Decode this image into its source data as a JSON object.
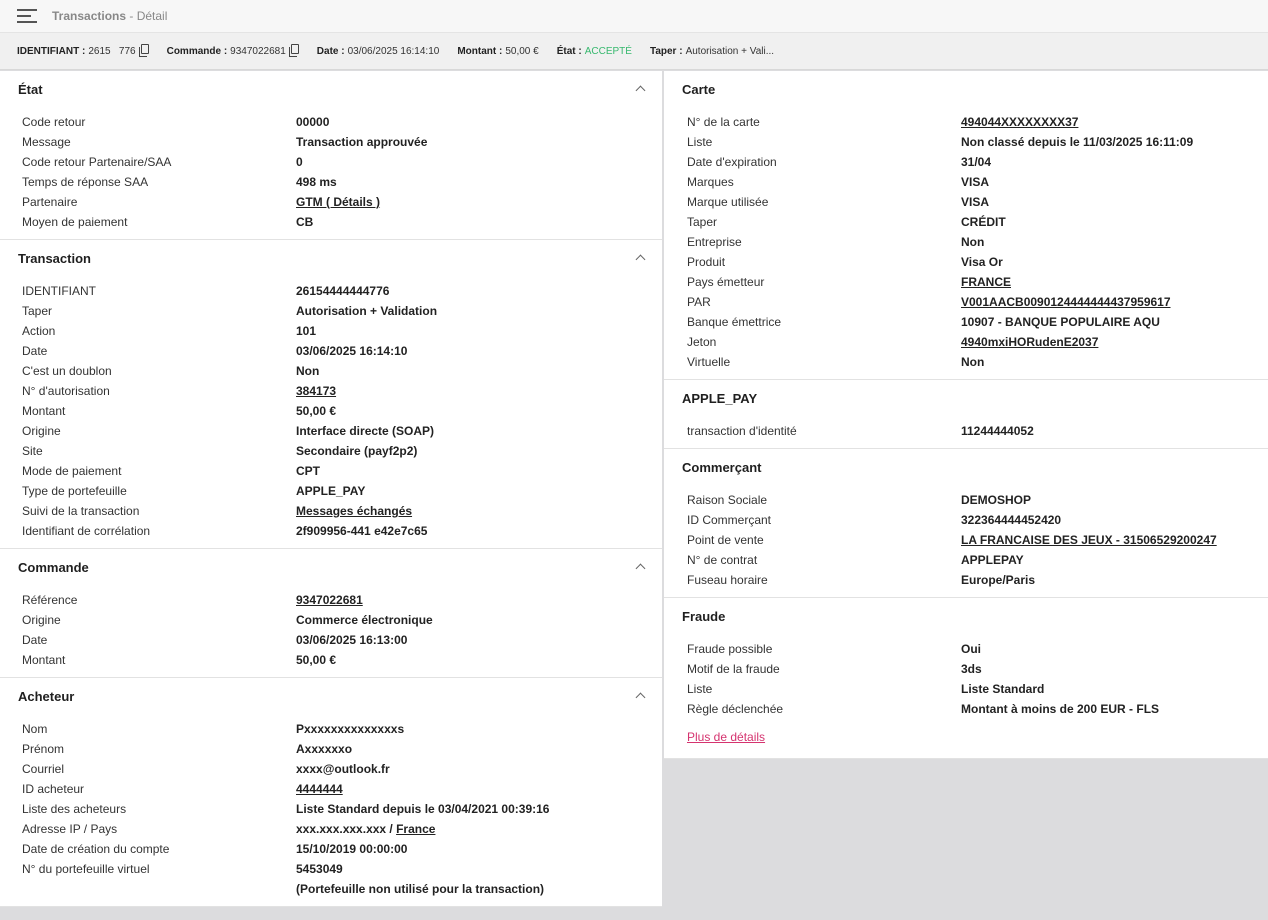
{
  "header": {
    "title": "Transactions",
    "subtitle": " - Détail"
  },
  "infobar": [
    {
      "key": "IDENTIFIANT :",
      "value": "2615    776",
      "copy": true
    },
    {
      "key": "Commande :",
      "value": "9347022681",
      "copy": true
    },
    {
      "key": "Date :",
      "value": "03/06/2025 16:14:10",
      "copy": false
    },
    {
      "key": "Montant :",
      "value": "50,00 €",
      "copy": false
    },
    {
      "key": "État :",
      "value": "ACCEPTÉ",
      "copy": false,
      "ok": true
    },
    {
      "key": "Taper :",
      "value": "Autorisation + Vali...",
      "copy": false
    }
  ],
  "colors": {
    "accent_ok": "#37b86e",
    "link_pink": "#d5336f"
  },
  "left": [
    {
      "title": "État",
      "rows": [
        {
          "label": "Code retour",
          "value": "00000"
        },
        {
          "label": "Message",
          "value": "Transaction approuvée"
        },
        {
          "label": "Code retour Partenaire/SAA",
          "value": "0"
        },
        {
          "label": "Temps de réponse SAA",
          "value": "498 ms"
        },
        {
          "label": "Partenaire",
          "value": "GTM ( Détails )",
          "link": true
        },
        {
          "label": "Moyen de paiement",
          "value": "CB"
        }
      ]
    },
    {
      "title": "Transaction",
      "rows": [
        {
          "label": "IDENTIFIANT",
          "value": "26154444444776"
        },
        {
          "label": "Taper",
          "value": "Autorisation + Validation"
        },
        {
          "label": "Action",
          "value": "101"
        },
        {
          "label": "Date",
          "value": "03/06/2025 16:14:10"
        },
        {
          "label": "C'est un doublon",
          "value": "Non"
        },
        {
          "label": "N° d'autorisation",
          "value": "384173",
          "link": true
        },
        {
          "label": "Montant",
          "value": "50,00 €"
        },
        {
          "label": "Origine",
          "value": "Interface directe (SOAP)"
        },
        {
          "label": "Site",
          "value": "Secondaire (payf2p2)"
        },
        {
          "label": "Mode de paiement",
          "value": "CPT"
        },
        {
          "label": "Type de portefeuille",
          "value": "APPLE_PAY"
        },
        {
          "label": "Suivi de la transaction",
          "value": "Messages échangés",
          "link": true
        },
        {
          "label": "Identifiant de corrélation",
          "value": "2f909956-441                                  e42e7c65"
        }
      ]
    },
    {
      "title": "Commande",
      "rows": [
        {
          "label": "Référence",
          "value": "9347022681",
          "link": true
        },
        {
          "label": "Origine",
          "value": "Commerce électronique"
        },
        {
          "label": "Date",
          "value": "03/06/2025 16:13:00"
        },
        {
          "label": "Montant",
          "value": "50,00 €"
        }
      ]
    },
    {
      "title": "Acheteur",
      "rows": [
        {
          "label": "Nom",
          "value": "Pxxxxxxxxxxxxxxs"
        },
        {
          "label": "Prénom",
          "value": "Axxxxxxo"
        },
        {
          "label": "Courriel",
          "value": "xxxx@outlook.fr"
        },
        {
          "label": "ID acheteur",
          "value": "4444444",
          "link": true
        },
        {
          "label": "Liste des acheteurs",
          "value": "Liste Standard depuis le 03/04/2021 00:39:16"
        },
        {
          "label": "Adresse IP / Pays",
          "value": "xxx.xxx.xxx.xxx / ",
          "suffix_link": "France"
        },
        {
          "label": "Date de création du compte",
          "value": "15/10/2019 00:00:00"
        },
        {
          "label": "N° du portefeuille virtuel",
          "value": "5453049"
        },
        {
          "label": "",
          "value": "(Portefeuille non utilisé pour la transaction)"
        }
      ]
    }
  ],
  "right": [
    {
      "title": "Carte",
      "rows": [
        {
          "label": "N° de la carte",
          "value": "494044XXXXXXXX37",
          "link": true
        },
        {
          "label": "Liste",
          "value": "Non classé depuis le 11/03/2025 16:11:09"
        },
        {
          "label": "Date d'expiration",
          "value": "31/04"
        },
        {
          "label": "Marques",
          "value": "VISA"
        },
        {
          "label": "Marque utilisée",
          "value": "VISA"
        },
        {
          "label": "Taper",
          "value": "CRÉDIT"
        },
        {
          "label": "Entreprise",
          "value": "Non"
        },
        {
          "label": "Produit",
          "value": "Visa Or"
        },
        {
          "label": "Pays émetteur",
          "value": "FRANCE",
          "link": true
        },
        {
          "label": "PAR",
          "value": "V001AACB0090124444444437959617",
          "link": true
        },
        {
          "label": "Banque émettrice",
          "value": "10907 - BANQUE POPULAIRE AQU"
        },
        {
          "label": "Jeton",
          "value": "4940mxiHORudenE2037",
          "link": true
        },
        {
          "label": "Virtuelle",
          "value": "Non"
        }
      ]
    },
    {
      "title": "APPLE_PAY",
      "rows": [
        {
          "label": "transaction d'identité",
          "value": "11244444052"
        }
      ]
    },
    {
      "title": "Commerçant",
      "rows": [
        {
          "label": "Raison Sociale",
          "value": "DEMOSHOP"
        },
        {
          "label": "ID Commerçant",
          "value": "322364444452420"
        },
        {
          "label": "Point de vente",
          "value": "LA FRANCAISE DES JEUX - 31506529200247",
          "link": true
        },
        {
          "label": "N° de contrat",
          "value": "APPLEPAY"
        },
        {
          "label": "Fuseau horaire",
          "value": "Europe/Paris"
        }
      ]
    },
    {
      "title": "Fraude",
      "rows": [
        {
          "label": "Fraude possible",
          "value": "Oui"
        },
        {
          "label": "Motif de la fraude",
          "value": "3ds"
        },
        {
          "label": "Liste",
          "value": "Liste Standard"
        },
        {
          "label": "Règle déclenchée",
          "value": "Montant à moins de 200 EUR - FLS"
        }
      ],
      "more_link": "Plus de détails"
    }
  ]
}
